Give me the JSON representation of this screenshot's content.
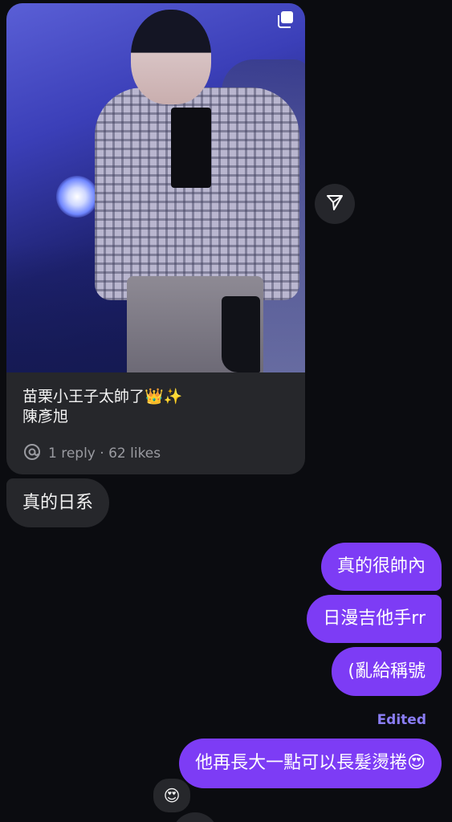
{
  "post": {
    "caption_line1": "苗栗小王子太帥了👑✨",
    "caption_line2": "陳彥旭",
    "meta": "1 reply · 62 likes",
    "platform_icon": "threads-icon",
    "multi_image_icon": "carousel-icon"
  },
  "share": {
    "icon": "send-icon"
  },
  "messages": {
    "incoming_1": "真的日系",
    "outgoing_1": "真的很帥內",
    "outgoing_2": "日漫吉他手rr",
    "outgoing_3": "(亂給稱號",
    "edited_label": "Edited",
    "outgoing_4": "他再長大一點可以長髮燙捲😍",
    "reaction": "😍"
  },
  "colors": {
    "background": "#0b0c10",
    "incoming_bubble": "#26272b",
    "outgoing_bubble": "#7d3cf5",
    "edited": "#8a7df5"
  }
}
